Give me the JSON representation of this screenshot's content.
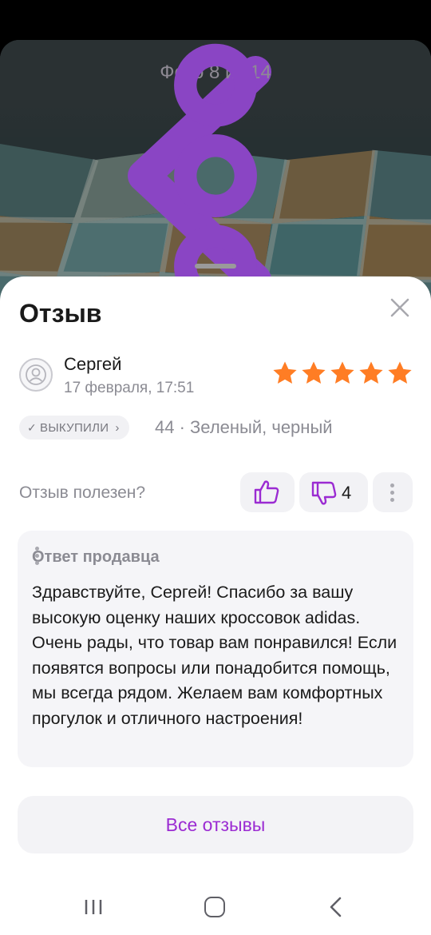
{
  "photo_viewer": {
    "counter": "Фото 8 из 14",
    "back_icon": "chevron-left-icon",
    "more_icon": "more-vertical-icon"
  },
  "review_sheet": {
    "title": "Отзыв",
    "close_icon": "close-icon",
    "author": {
      "name": "Сергей",
      "date": "17 февраля, 17:51",
      "avatar_icon": "user-avatar-icon"
    },
    "rating": 5,
    "rating_max": 5,
    "star_color": "#ff7d24",
    "badge": {
      "label": "ВЫКУПИЛИ",
      "check": "✓",
      "chevron": "›"
    },
    "variant": "44 · Зеленый, черный",
    "helpful": {
      "question": "Отзыв полезен?",
      "dislike_count": "4"
    },
    "seller_reply": {
      "title": "Ответ продавца",
      "text": "Здравствуйте, Сергей! Спасибо за вашу высокую оценку наших кроссовок adidas. Очень рады, что товар вам понравился! Если появятся вопросы или понадобится помощь, мы всегда рядом. Желаем вам комфортных прогулок и отличного настроения!"
    },
    "all_reviews_label": "Все отзывы"
  },
  "colors": {
    "accent": "#9b2bd2",
    "star": "#ff7d24",
    "muted_text": "#8b8b93"
  }
}
